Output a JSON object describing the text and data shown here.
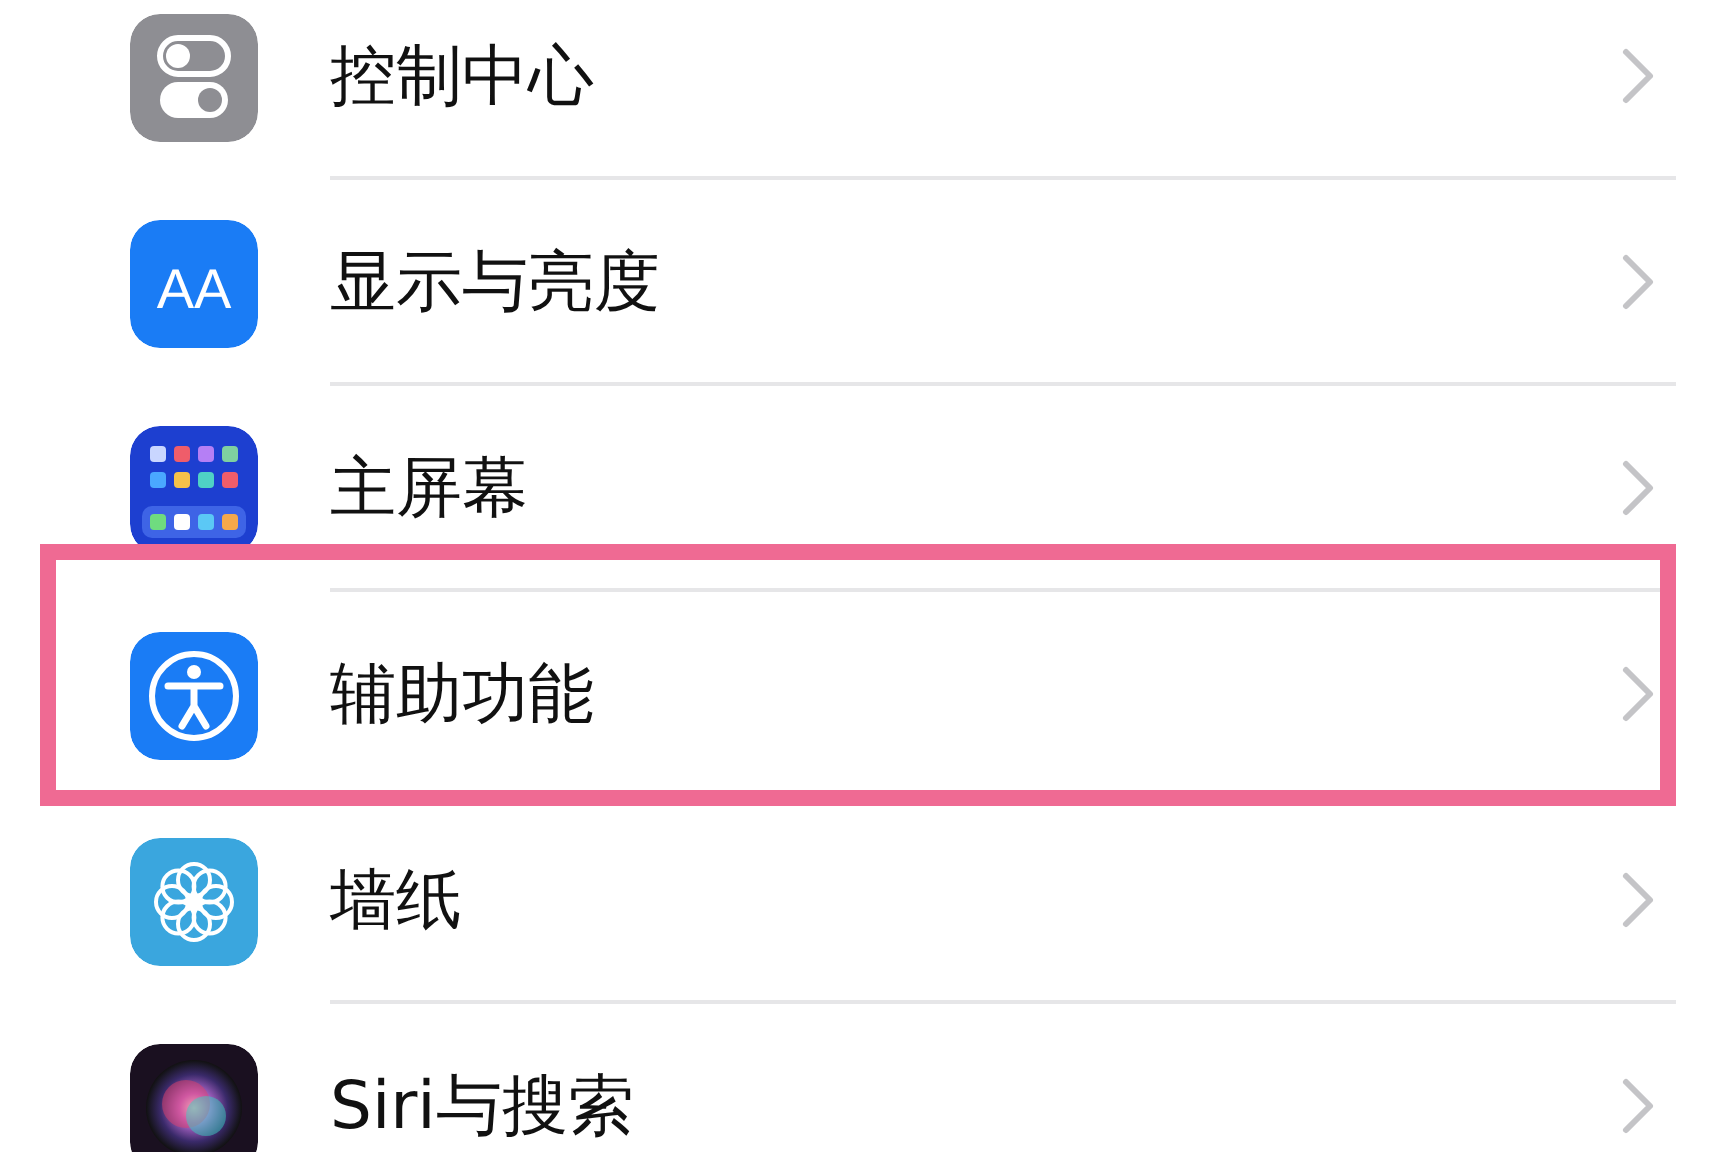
{
  "settings_list": [
    {
      "label": "控制中心",
      "kind": "toggles",
      "highlighted": false
    },
    {
      "label": "显示与亮度",
      "kind": "textsize",
      "icon_text": "AA",
      "highlighted": false
    },
    {
      "label": "主屏幕",
      "kind": "grid",
      "highlighted": false
    },
    {
      "label": "辅助功能",
      "kind": "accessibility",
      "highlighted": true
    },
    {
      "label": "墙纸",
      "kind": "flower",
      "highlighted": false
    },
    {
      "label": "Siri与搜索",
      "kind": "orb",
      "highlighted": false
    }
  ]
}
